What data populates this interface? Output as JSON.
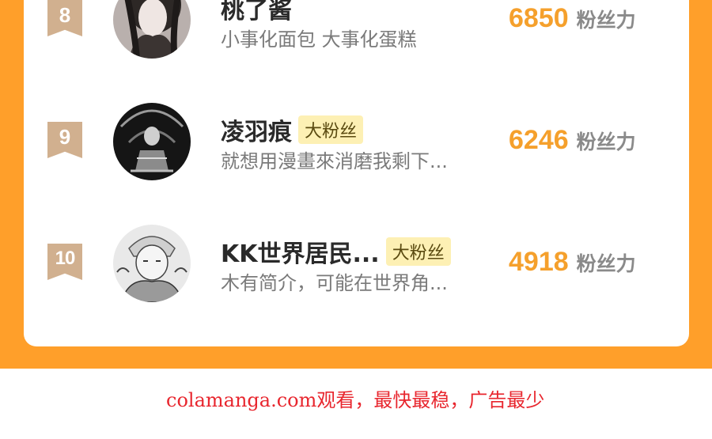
{
  "leaderboard": {
    "rows": [
      {
        "rank": "8",
        "name": "桃了酱",
        "badge": "",
        "bio": "小事化面包 大事化蛋糕",
        "score": "6850",
        "score_label": "粉丝力"
      },
      {
        "rank": "9",
        "name": "凌羽痕",
        "badge": "大粉丝",
        "bio": "就想用漫畫來消磨我剩下...",
        "score": "6246",
        "score_label": "粉丝力"
      },
      {
        "rank": "10",
        "name": "KK世界居民...",
        "badge": "大粉丝",
        "bio": "木有简介，可能在世界角...",
        "score": "4918",
        "score_label": "粉丝力"
      }
    ]
  },
  "footer": {
    "text": "colamanga.com观看，最快最稳，广告最少"
  },
  "colors": {
    "accent_orange": "#ff9f2a",
    "score_orange": "#f5a02c",
    "rank_tan": "#d1b08f",
    "badge_yellow": "#fdf0b4",
    "footer_red": "#e8262e"
  }
}
